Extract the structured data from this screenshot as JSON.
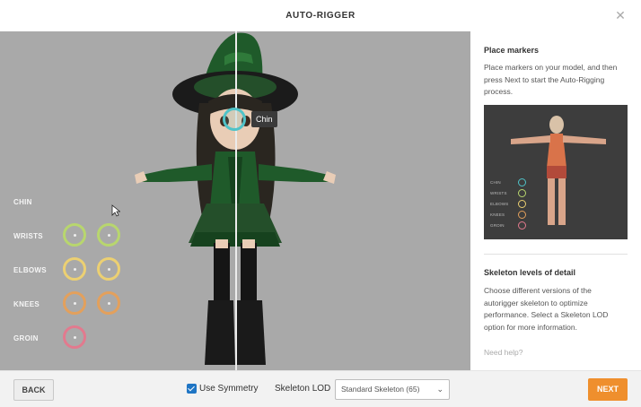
{
  "window": {
    "title": "AUTO-RIGGER"
  },
  "viewport": {
    "chin_tooltip": "Chin",
    "markers": [
      {
        "label": "CHIN"
      },
      {
        "label": "WRISTS"
      },
      {
        "label": "ELBOWS"
      },
      {
        "label": "KNEES"
      },
      {
        "label": "GROIN"
      }
    ]
  },
  "panel": {
    "place_title": "Place markers",
    "place_text": "Place markers on your model, and then press Next to start the Auto-Rigging process.",
    "preview_labels": [
      "CHIN",
      "WRISTS",
      "ELBOWS",
      "KNEES",
      "GROIN"
    ],
    "lod_title": "Skeleton levels of detail",
    "lod_text": "Choose different versions of the autorigger skeleton to optimize performance. Select a Skeleton LOD option for more information.",
    "help": "Need help?"
  },
  "footer": {
    "back": "BACK",
    "use_symmetry": "Use Symmetry",
    "use_symmetry_checked": true,
    "lod_label": "Skeleton LOD",
    "lod_value": "Standard Skeleton (65)",
    "next": "NEXT"
  },
  "colors": {
    "chin": "#4fc3c8",
    "wrists": "#b8d66e",
    "elbows": "#ecd072",
    "knees": "#e3a05c",
    "groin": "#e27a8e",
    "next_button": "#ef8f2d"
  },
  "icons": {
    "close": "close-icon",
    "cursor": "mouse-cursor-icon",
    "dropdown": "chevron-down-icon"
  }
}
